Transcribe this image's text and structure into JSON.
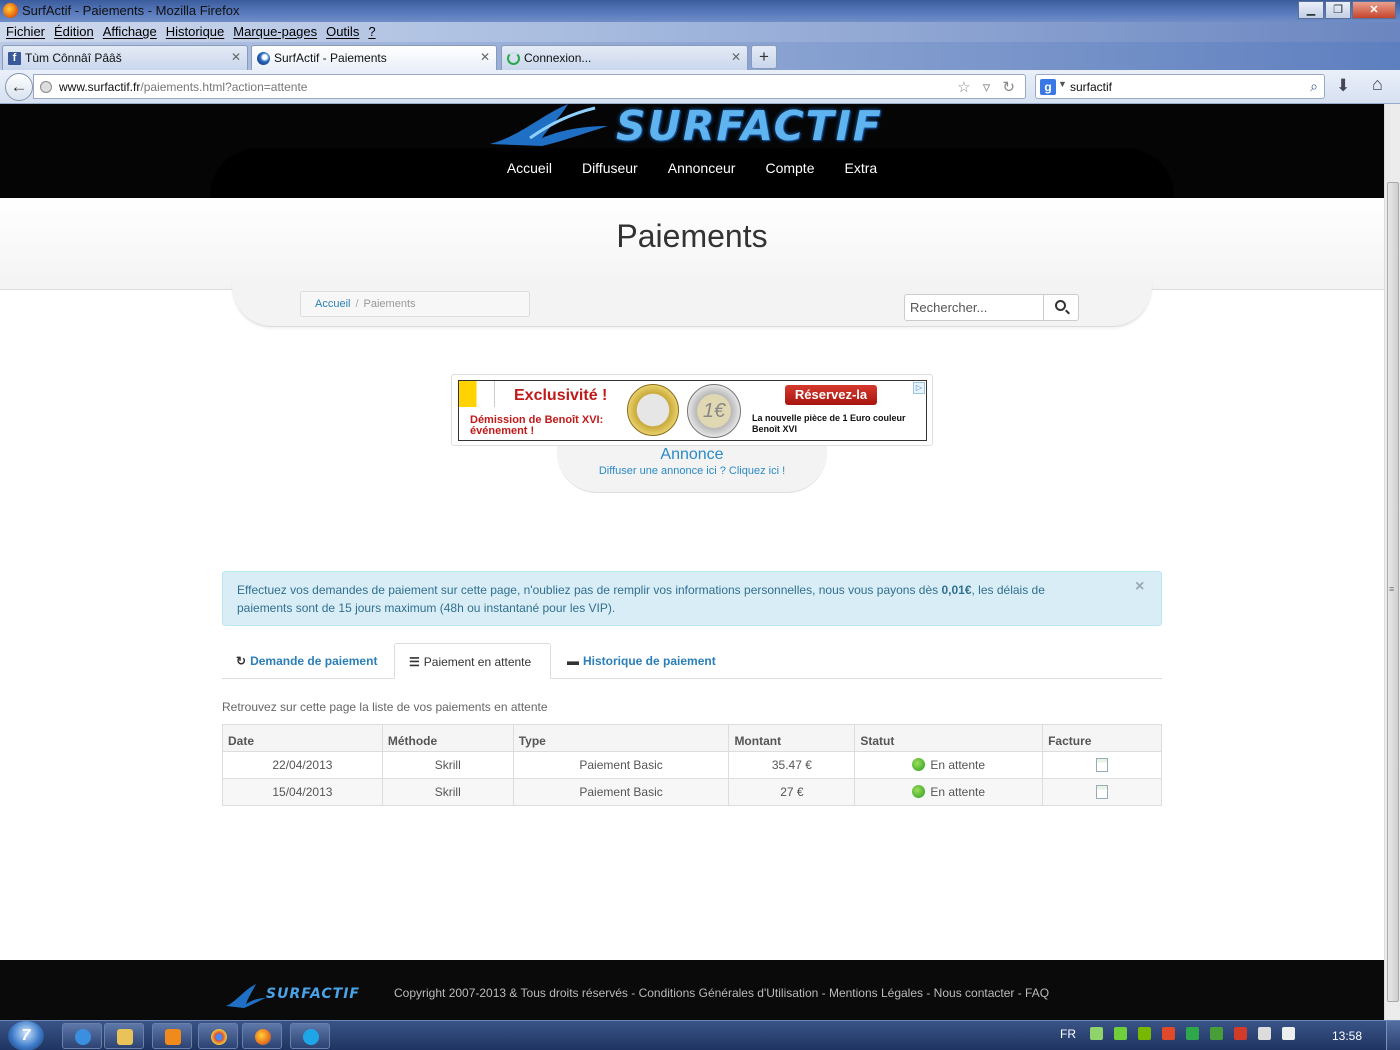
{
  "window": {
    "title": "SurfActif - Paiements - Mozilla Firefox",
    "controls": {
      "minimize": "▁",
      "maximize": "❐",
      "close": "✕"
    }
  },
  "menu": [
    "Fichier",
    "Édition",
    "Affichage",
    "Historique",
    "Marque-pages",
    "Outils",
    "?"
  ],
  "tabs": [
    {
      "label": "Tùm Cônnâî Pââš",
      "icon": "facebook-icon"
    },
    {
      "label": "SurfActif - Paiements",
      "icon": "surfactif-icon"
    },
    {
      "label": "Connexion...",
      "icon": "loading-icon"
    }
  ],
  "toolbar": {
    "url_host": "www.surfactif.fr",
    "url_path": "/paiements.html?action=attente",
    "search_value": "surfactif",
    "google_glyph": "g",
    "new_tab_glyph": "+",
    "back_glyph": "←",
    "url_icons": "☆ ▿ ↻",
    "search_glyph": "⌕",
    "download_glyph": "⬇",
    "home_glyph": "⌂"
  },
  "site": {
    "logo_text": "SURFACTIF",
    "nav": [
      "Accueil",
      "Diffuseur",
      "Annonceur",
      "Compte",
      "Extra"
    ],
    "page_title": "Paiements",
    "breadcrumb": {
      "home": "Accueil",
      "separator": "/",
      "current": "Paiements"
    },
    "search_placeholder": "Rechercher..."
  },
  "ad": {
    "headline": "Exclusivité !",
    "subline": "Démission de Benoît XVI: événement !",
    "cta": "Réservez-la",
    "description": "La nouvelle pièce de 1 Euro couleur Benoît XVI",
    "choices_glyph": "▷",
    "coin_glyph": "1€",
    "label": "Annonce",
    "link": "Diffuser une annonce ici ? Cliquez ici !"
  },
  "alert": {
    "text_before": "Effectuez vos demandes de paiement sur cette page, n'oubliez pas de remplir vos informations personnelles, nous vous payons dès ",
    "amount": "0,01€",
    "text_after": ", les délais de paiements sont de 15 jours maximum (48h ou instantané pour les VIP).",
    "close_glyph": "×"
  },
  "payment_tabs": [
    {
      "label": "Demande de paiement",
      "icon": "refresh-icon",
      "glyph": "↻"
    },
    {
      "label": "Paiement en attente",
      "icon": "list-icon",
      "glyph": "☰"
    },
    {
      "label": "Historique de paiement",
      "icon": "folder-icon",
      "glyph": "▬"
    }
  ],
  "intro": "Retrouvez sur cette page la liste de vos paiements en attente",
  "table": {
    "headers": [
      "Date",
      "Méthode",
      "Type",
      "Montant",
      "Statut",
      "Facture"
    ],
    "rows": [
      {
        "date": "22/04/2013",
        "method": "Skrill",
        "type": "Paiement Basic",
        "amount": "35.47 €",
        "status": "En attente"
      },
      {
        "date": "15/04/2013",
        "method": "Skrill",
        "type": "Paiement Basic",
        "amount": "27 €",
        "status": "En attente"
      }
    ]
  },
  "footer": {
    "logo_text": "SURFACTIF",
    "links": "Copyright 2007-2013 & Tous droits réservés - Conditions Générales d'Utilisation - Mentions Légales - Nous contacter - FAQ"
  },
  "taskbar": {
    "language": "FR",
    "clock": "13:58",
    "start_glyph": "7",
    "apps": [
      {
        "icon": "internet-explorer-icon",
        "color": "#3b8fe0"
      },
      {
        "icon": "folder-icon",
        "color": "#e9c25a"
      },
      {
        "icon": "media-player-icon",
        "color": "#f08a1c"
      },
      {
        "icon": "chrome-icon",
        "color": "#d9453a"
      },
      {
        "icon": "firefox-icon",
        "color": "#e8731c"
      },
      {
        "icon": "skype-icon",
        "color": "#1ea7e8"
      }
    ],
    "tray": [
      {
        "icon": "network-icon",
        "color": "#8fd46a"
      },
      {
        "icon": "app-tray-icon",
        "color": "#6fcf3a"
      },
      {
        "icon": "nvidia-icon",
        "color": "#76b900"
      },
      {
        "icon": "volume-warning-icon",
        "color": "#e04a2a"
      },
      {
        "icon": "check-icon",
        "color": "#2ea84a"
      },
      {
        "icon": "globe-icon",
        "color": "#4a9e3a"
      },
      {
        "icon": "flag-icon",
        "color": "#d23a2a"
      },
      {
        "icon": "display-icon",
        "color": "#dcdcdc"
      },
      {
        "icon": "speaker-icon",
        "color": "#eeeeee"
      }
    ]
  },
  "colors": {
    "accent": "#2a7fb8",
    "alert_bg": "#d9edf7",
    "alert_text": "#31708f",
    "header_bg": "#050505"
  }
}
